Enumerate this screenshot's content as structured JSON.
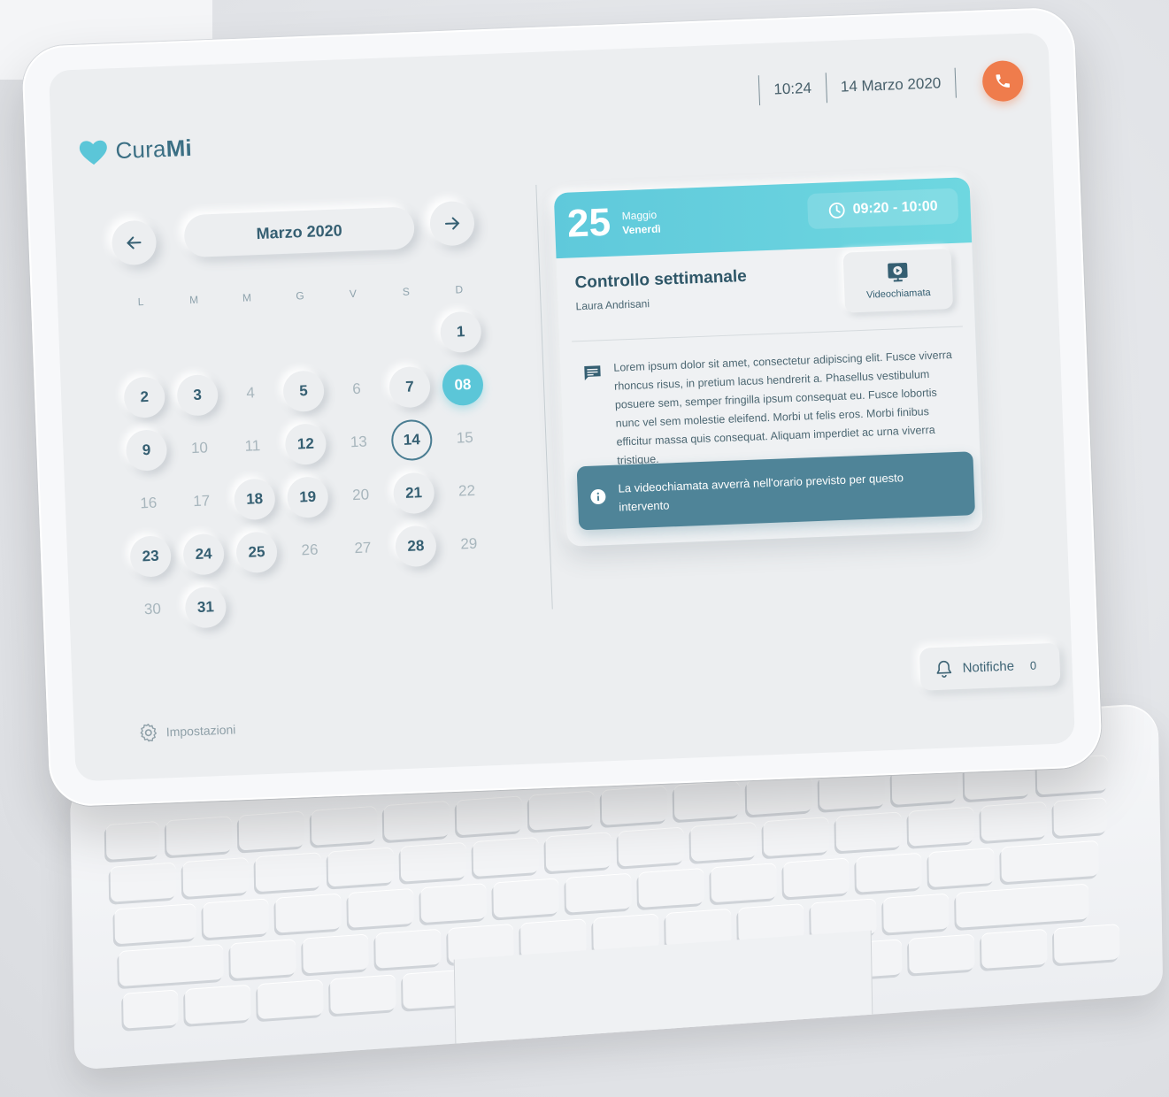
{
  "app": {
    "name_prefix": "Cura",
    "name_suffix": "Mi"
  },
  "topbar": {
    "time": "10:24",
    "date": "14 Marzo 2020"
  },
  "calendar": {
    "month": "Marzo 2020",
    "weekdays": [
      "L",
      "M",
      "M",
      "G",
      "V",
      "S",
      "D"
    ],
    "today": "08",
    "selected": "14"
  },
  "appointment": {
    "day": "25",
    "month": "Maggio",
    "weekday": "Venerdì",
    "time_range": "09:20 - 10:00",
    "title": "Controllo settimanale",
    "person": "Laura Andrisani",
    "video_label": "Videochiamata",
    "description": "Lorem ipsum dolor sit amet, consectetur adipiscing elit. Fusce viverra rhoncus risus, in pretium lacus hendrerit a. Phasellus vestibulum posuere sem, semper fringilla ipsum consequat eu. Fusce lobortis nunc vel sem molestie eleifend. Morbi ut felis eros. Morbi finibus efficitur massa quis consequat. Aliquam imperdiet ac urna viverra tristique.",
    "info": "La videochiamata avverrà nell'orario previsto per questo intervento"
  },
  "footer": {
    "settings_label": "Impostazioni",
    "notifications_label": "Notifiche",
    "notifications_count": "0"
  },
  "colors": {
    "accent": "#5bc6d8",
    "call": "#ef7c4c",
    "info_bar": "#4f8498",
    "brand_text": "#3b6f84"
  }
}
